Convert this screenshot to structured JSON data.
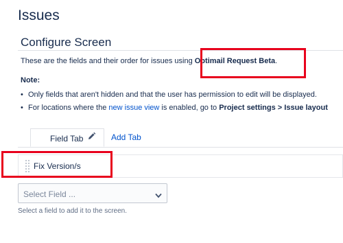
{
  "page": {
    "title": "Issues"
  },
  "screen": {
    "title": "Configure Screen",
    "desc_prefix": "These are the fields and their order for issues using ",
    "desc_bold": "Optimail Request Beta",
    "desc_suffix": "."
  },
  "note": {
    "label": "Note:",
    "item1": "Only fields that aren't hidden and that the user has permission to edit will be displayed.",
    "item2_prefix": "For locations where the ",
    "item2_link": "new issue view",
    "item2_mid": " is enabled, go to ",
    "item2_bold": "Project settings > Issue layout"
  },
  "tabs": {
    "active_label": "Field Tab",
    "add_label": "Add Tab"
  },
  "fields": [
    {
      "name": "Fix Version/s"
    }
  ],
  "select": {
    "placeholder": "Select Field ...",
    "hint": "Select a field to add it to the screen."
  },
  "icons": {
    "tab_edit": "pencil-icon",
    "field_handle": "drag-handle-icon",
    "select_arrow": "chevron-down-icon"
  },
  "colors": {
    "link": "#0052cc",
    "highlight": "#e8001c",
    "text": "#172b4d"
  }
}
